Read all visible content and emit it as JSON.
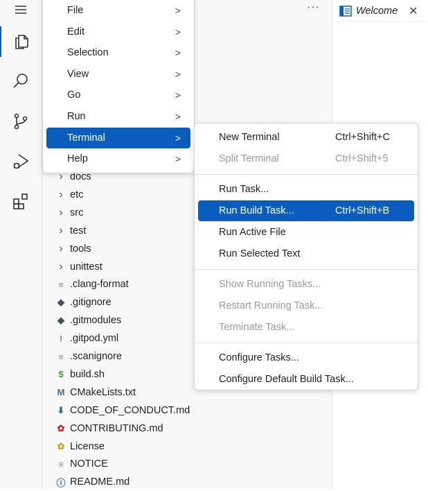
{
  "activity_bar": {
    "items": [
      {
        "icon": "hamburger-menu-icon"
      },
      {
        "icon": "explorer-icon"
      },
      {
        "icon": "search-icon"
      },
      {
        "icon": "source-control-icon"
      },
      {
        "icon": "run-debug-icon"
      },
      {
        "icon": "extensions-icon"
      }
    ]
  },
  "sidebar": {
    "more_actions": "···"
  },
  "editor": {
    "tab_title": "Welcome",
    "close_glyph": "✕"
  },
  "explorer": {
    "folders": [
      "docs",
      "etc",
      "src",
      "test",
      "tools",
      "unittest"
    ],
    "files": [
      {
        "icon": "≡",
        "name": ".clang-format",
        "color": "#8a8a8a"
      },
      {
        "icon": "◆",
        "name": ".gitignore",
        "color": "#41535b"
      },
      {
        "icon": "◆",
        "name": ".gitmodules",
        "color": "#41535b"
      },
      {
        "icon": "!",
        "name": ".gitpod.yml",
        "color": "#a074c4"
      },
      {
        "icon": "≡",
        "name": ".scanignore",
        "color": "#8a8a8a"
      },
      {
        "icon": "$",
        "name": "build.sh",
        "color": "#4d9a3f"
      },
      {
        "icon": "M",
        "name": "CMakeLists.txt",
        "color": "#3b6ea5"
      },
      {
        "icon": "⬇",
        "name": "CODE_OF_CONDUCT.md",
        "color": "#3b6ea5"
      },
      {
        "icon": "✿",
        "name": "CONTRIBUTING.md",
        "color": "#c62828"
      },
      {
        "icon": "✿",
        "name": "License",
        "color": "#c9a227"
      },
      {
        "icon": "≡",
        "name": "NOTICE",
        "color": "#8a8a8a"
      },
      {
        "icon": "ⓘ",
        "name": "README.md",
        "color": "#3b6ea5"
      }
    ]
  },
  "main_menu": {
    "items": [
      "File",
      "Edit",
      "Selection",
      "View",
      "Go",
      "Run",
      "Terminal",
      "Help"
    ],
    "selected": "Terminal",
    "chevron": ">"
  },
  "terminal_menu": {
    "groups": [
      [
        {
          "label": "New Terminal",
          "shortcut": "Ctrl+Shift+C",
          "disabled": false
        },
        {
          "label": "Split Terminal",
          "shortcut": "Ctrl+Shift+5",
          "disabled": true
        }
      ],
      [
        {
          "label": "Run Task...",
          "shortcut": "",
          "disabled": false
        },
        {
          "label": "Run Build Task...",
          "shortcut": "Ctrl+Shift+B",
          "disabled": false,
          "selected": true
        },
        {
          "label": "Run Active File",
          "shortcut": "",
          "disabled": false
        },
        {
          "label": "Run Selected Text",
          "shortcut": "",
          "disabled": false
        }
      ],
      [
        {
          "label": "Show Running Tasks...",
          "shortcut": "",
          "disabled": true
        },
        {
          "label": "Restart Running Task...",
          "shortcut": "",
          "disabled": true
        },
        {
          "label": "Terminate Task...",
          "shortcut": "",
          "disabled": true
        }
      ],
      [
        {
          "label": "Configure Tasks...",
          "shortcut": "",
          "disabled": false
        },
        {
          "label": "Configure Default Build Task...",
          "shortcut": "",
          "disabled": false
        }
      ]
    ]
  },
  "colors": {
    "accent": "#0a5dbd",
    "disabled": "#9a9a9a"
  }
}
